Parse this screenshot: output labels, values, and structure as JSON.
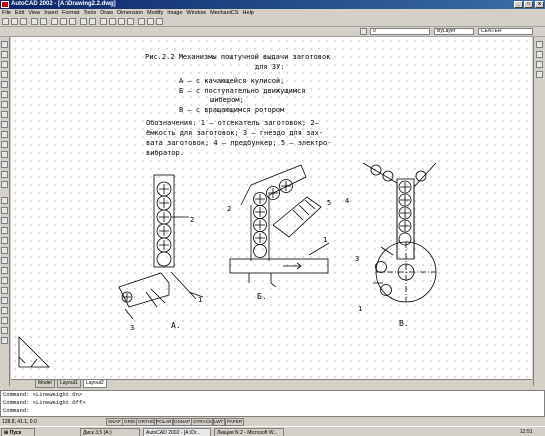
{
  "window": {
    "title": "AutoCAD 2002 - [A:\\Drawing2.2.dwg]",
    "minimize": "_",
    "maximize": "□",
    "close": "x"
  },
  "menu": [
    "File",
    "Edit",
    "View",
    "Insert",
    "Format",
    "Tools",
    "Draw",
    "Dimension",
    "Modify",
    "Image",
    "Window",
    "MechaniCS",
    "Help"
  ],
  "properties_bar": {
    "layer": "0",
    "color": "ByLayer",
    "linetype": "CENTER"
  },
  "drawing": {
    "title_lines": [
      "Рис.2.2 Механизмы поштучной выдачи заготовок",
      "для ЗУ:"
    ],
    "items": [
      "А – с качающейся кулисой;",
      "Б – с поступательно движущимся",
      "шибером;",
      "В – с вращающимся ротором"
    ],
    "legend_lines": [
      "Обозначения: 1 – отсекатель заготовок; 2–",
      "ёмкость для заготовок; 3 – гнездо для зах-",
      "вата заготовок; 4 – предбункер; 5 – электро-",
      "вибратор."
    ],
    "labels": {
      "a1": "1",
      "a2": "2",
      "a3": "3",
      "a_caption": "А.",
      "b1": "1",
      "b2": "2",
      "b5": "5",
      "b_caption": "Б.",
      "v1": "1",
      "v3": "3",
      "v4": "4",
      "v_caption": "В."
    }
  },
  "tabs": [
    "Model",
    "Layout1",
    "Layout2"
  ],
  "command_lines": [
    "Command:  <Lineweight On>",
    "Command:  <Lineweight Off>",
    "Command:"
  ],
  "status": {
    "coords": "128.8, 41.1, 0.0",
    "buttons": [
      "SNAP",
      "GRID",
      "ORTHO",
      "POLAR",
      "OSNAP",
      "OTRACK",
      "LWT",
      "PAPER"
    ]
  },
  "taskbar": {
    "start": "Пуск",
    "tasks": [
      "Диск 3,5 (A:)",
      "AutoCAD 2002 - [A:\\Dr...",
      "Лекция N 2 - Microsoft W..."
    ],
    "clock": "12:51"
  }
}
